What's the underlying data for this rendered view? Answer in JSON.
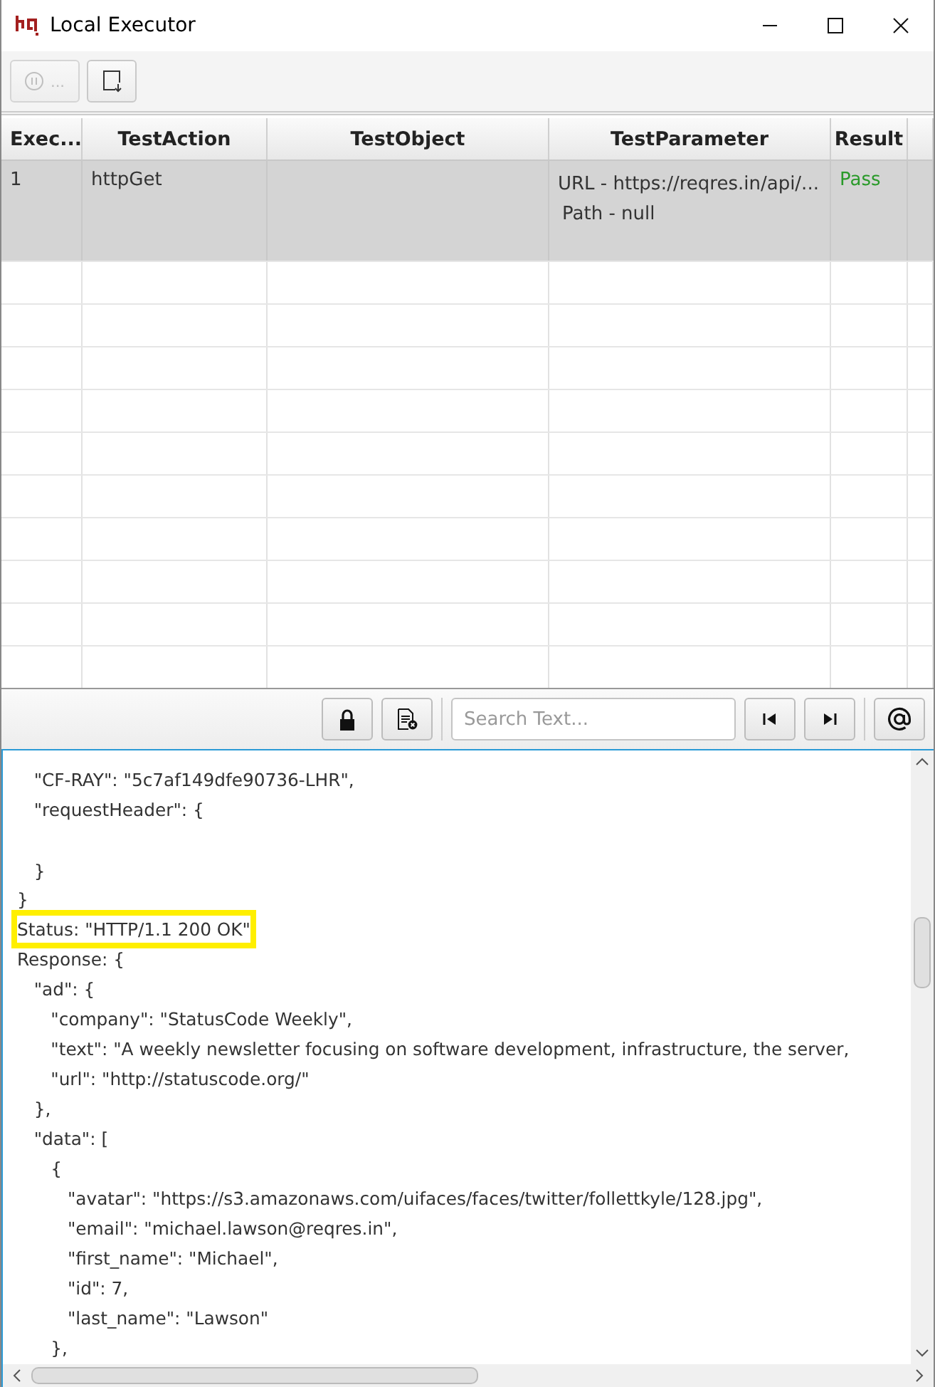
{
  "window": {
    "title": "Local Executor"
  },
  "toolbar": {
    "buttons": [
      {
        "kind": "pause",
        "label": "...",
        "disabled": true
      },
      {
        "kind": "export",
        "disabled": false
      }
    ]
  },
  "table": {
    "columns": [
      "Exec...",
      "TestAction",
      "TestObject",
      "TestParameter",
      "Result"
    ],
    "rows": [
      {
        "selected": true,
        "cells": [
          "1",
          "httpGet",
          "",
          [
            "URL - https://reqres.in/api/...",
            "Path - null"
          ],
          "Pass"
        ]
      }
    ]
  },
  "log_toolbar": {
    "search": {
      "placeholder": "Search Text..."
    }
  },
  "log": {
    "lines": [
      {
        "text": "   \"CF-RAY\": \"5c7af149dfe90736-LHR\",",
        "highlighted": false
      },
      {
        "text": "   \"requestHeader\": {",
        "highlighted": false
      },
      {
        "text": "   }",
        "highlighted": false,
        "gap_before": true
      },
      {
        "text": "}",
        "highlighted": false
      },
      {
        "text": "Status: \"HTTP/1.1 200 OK\"",
        "highlighted": true
      },
      {
        "text": "Response: {",
        "highlighted": false
      },
      {
        "text": "   \"ad\": {",
        "highlighted": false
      },
      {
        "text": "      \"company\": \"StatusCode Weekly\",",
        "highlighted": false
      },
      {
        "text": "      \"text\": \"A weekly newsletter focusing on software development, infrastructure, the server,",
        "highlighted": false
      },
      {
        "text": "      \"url\": \"http://statuscode.org/\"",
        "highlighted": false
      },
      {
        "text": "   },",
        "highlighted": false
      },
      {
        "text": "   \"data\": [",
        "highlighted": false
      },
      {
        "text": "      {",
        "highlighted": false
      },
      {
        "text": "         \"avatar\": \"https://s3.amazonaws.com/uifaces/faces/twitter/follettkyle/128.jpg\",",
        "highlighted": false
      },
      {
        "text": "         \"email\": \"michael.lawson@reqres.in\",",
        "highlighted": false
      },
      {
        "text": "         \"first_name\": \"Michael\",",
        "highlighted": false
      },
      {
        "text": "         \"id\": 7,",
        "highlighted": false
      },
      {
        "text": "         \"last_name\": \"Lawson\"",
        "highlighted": false
      },
      {
        "text": "      },",
        "highlighted": false
      }
    ]
  }
}
